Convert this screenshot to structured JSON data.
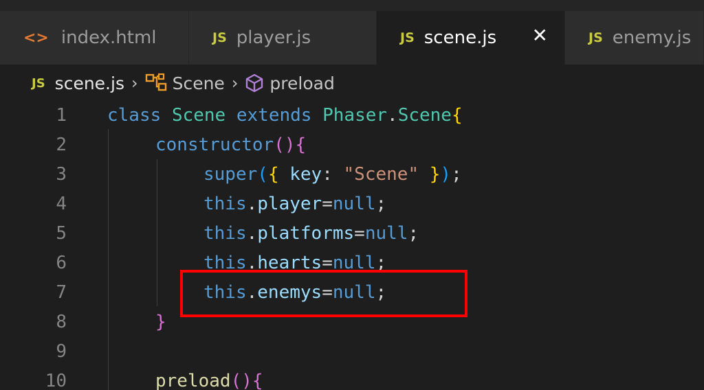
{
  "tabs": [
    {
      "icon": "<>",
      "label": "index.html"
    },
    {
      "icon": "JS",
      "label": "player.js"
    },
    {
      "icon": "JS",
      "label": "scene.js",
      "close": "✕"
    },
    {
      "icon": "JS",
      "label": "enemy.js"
    }
  ],
  "breadcrumb": {
    "js_icon": "JS",
    "file": "scene.js",
    "sep": "›",
    "class_name": "Scene",
    "method_name": "preload"
  },
  "lines": [
    {
      "num": "1"
    },
    {
      "num": "2"
    },
    {
      "num": "3"
    },
    {
      "num": "4"
    },
    {
      "num": "5"
    },
    {
      "num": "6"
    },
    {
      "num": "7"
    },
    {
      "num": "8"
    },
    {
      "num": "9"
    },
    {
      "num": "10"
    }
  ],
  "code": {
    "l1": {
      "class": "class",
      "name": "Scene",
      "extends": "extends",
      "parent": "Phaser",
      "dot": ".",
      "parent_cls": "Scene",
      "brace": "{"
    },
    "l2": {
      "ctor": "constructor",
      "paren_open": "(",
      "paren_close": ")",
      "brace": "{"
    },
    "l3": {
      "super": "super",
      "paren_open": "(",
      "brace_open": "{",
      "key": " key",
      "colon": ": ",
      "value": "\"Scene\"",
      "brace_close": " }",
      "paren_close": ")",
      "semi": ";"
    },
    "l4": {
      "this": "this",
      "dot": ".",
      "prop": "player",
      "eq": "=",
      "null": "null",
      "semi": ";"
    },
    "l5": {
      "this": "this",
      "dot": ".",
      "prop": "platforms",
      "eq": "=",
      "null": "null",
      "semi": ";"
    },
    "l6": {
      "this": "this",
      "dot": ".",
      "prop": "hearts",
      "eq": "=",
      "null": "null",
      "semi": ";"
    },
    "l7": {
      "this": "this",
      "dot": ".",
      "prop": "enemys",
      "eq": "=",
      "null": "null",
      "semi": ";"
    },
    "l8": {
      "brace": "}"
    },
    "l10": {
      "fn": "preload",
      "paren_open": "(",
      "paren_close": ")",
      "brace": "{"
    }
  },
  "colors": {
    "editor_bg": "#1e1e1e",
    "highlight": "#ff0000",
    "js_icon": "#cbcb41",
    "html_icon": "#e37933"
  }
}
